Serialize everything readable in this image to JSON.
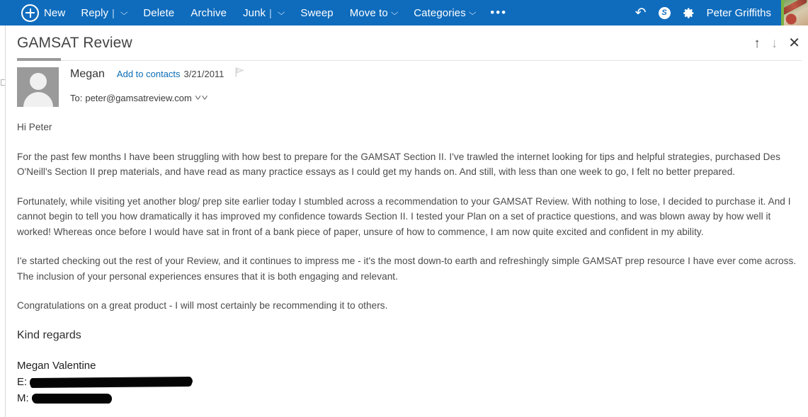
{
  "toolbar": {
    "new_label": "New",
    "reply_label": "Reply",
    "delete_label": "Delete",
    "archive_label": "Archive",
    "junk_label": "Junk",
    "sweep_label": "Sweep",
    "move_to_label": "Move to",
    "categories_label": "Categories",
    "more_label": "•••",
    "split_divider": "|",
    "caret": "⌵",
    "undo_icon": "↶",
    "skype_icon_letter": "S",
    "user_name": "Peter Griffiths",
    "accent_color": "#0f6cbd",
    "green_edge_color": "#7cb342"
  },
  "reading_pane": {
    "subject": "GAMSAT Review",
    "actions": {
      "previous_label": "↑",
      "next_label": "↓",
      "close_label": "✕"
    },
    "from": {
      "sender_name": "Megan",
      "add_to_contacts": "Add to contacts",
      "date": "3/21/2011",
      "to_label": "To:",
      "to_address": "peter@gamsatreview.com",
      "expand_chevron": "˅˅"
    },
    "body": {
      "greeting": "Hi Peter",
      "paragraph_1": "For the past few months I have been struggling with how best to prepare for the GAMSAT Section II. I've trawled the internet looking for tips and helpful strategies, purchased Des O'Neill's Section II prep materials, and have read as many practice essays as I could get my hands on. And still, with less than one week to go, I felt no better prepared.",
      "paragraph_2": "Fortunately, while visiting yet another blog/ prep site earlier today I stumbled across a recommendation to your GAMSAT Review. With nothing to lose, I decided to purchase it. And I cannot begin to tell you how dramatically it has improved my confidence towards Section II. I tested your Plan on a set of practice questions, and was blown away by how well it worked! Whereas once before I would have sat in front of a bank piece of paper, unsure of how to commence, I am now quite excited and confident in my ability.",
      "paragraph_3": "I'e started checking out the rest of your Review, and it continues to impress me - it's the most down-to earth and refreshingly simple GAMSAT prep resource I have ever come across. The inclusion of your personal experiences ensures that it is both engaging and relevant.",
      "paragraph_4": "Congratulations on a great product - I will most certainly be recommending it to others.",
      "sign_off": "Kind regards",
      "signature_name": "Megan Valentine",
      "signature_email_label": "E:",
      "signature_email_value": "",
      "signature_mobile_label": "M:",
      "signature_mobile_value": ""
    }
  }
}
